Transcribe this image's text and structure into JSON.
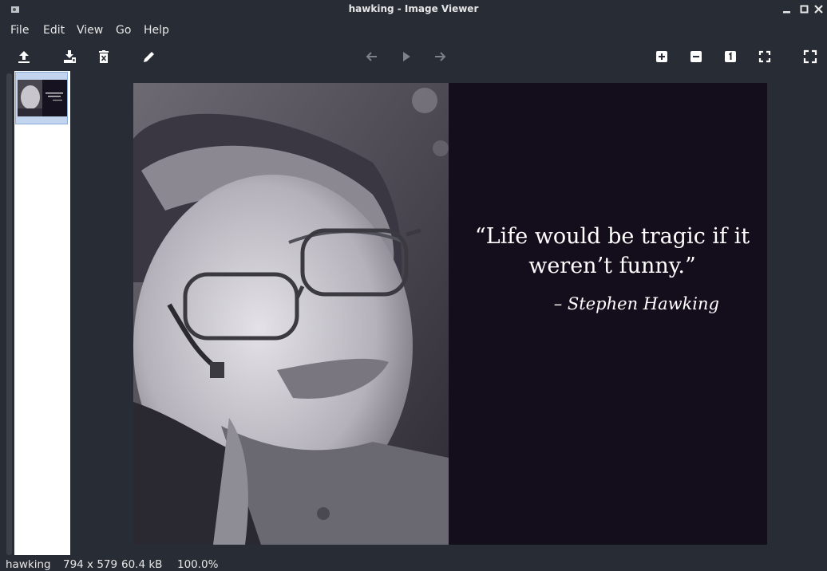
{
  "window": {
    "title": "hawking - Image Viewer"
  },
  "menu": [
    "File",
    "Edit",
    "View",
    "Go",
    "Help"
  ],
  "toolbar": {
    "left": [
      "upload-icon",
      "save-icon",
      "delete-icon",
      "edit-icon"
    ],
    "nav": [
      "back-icon",
      "play-icon",
      "forward-icon"
    ],
    "right": [
      "zoom-in-icon",
      "zoom-out-icon",
      "actual-size-icon",
      "fit-icon",
      "fullscreen-icon"
    ]
  },
  "image": {
    "quote_line1": "“Life would be tragic if it",
    "quote_line2": "weren’t funny.”",
    "author": "– Stephen Hawking"
  },
  "status": {
    "name": "hawking",
    "dimensions": "794 x 579",
    "size": "60.4 kB",
    "zoom": "100.0%"
  },
  "colors": {
    "background": "#282c34",
    "quote_bg": "#140e1c",
    "selection": "#c3d4ee"
  }
}
